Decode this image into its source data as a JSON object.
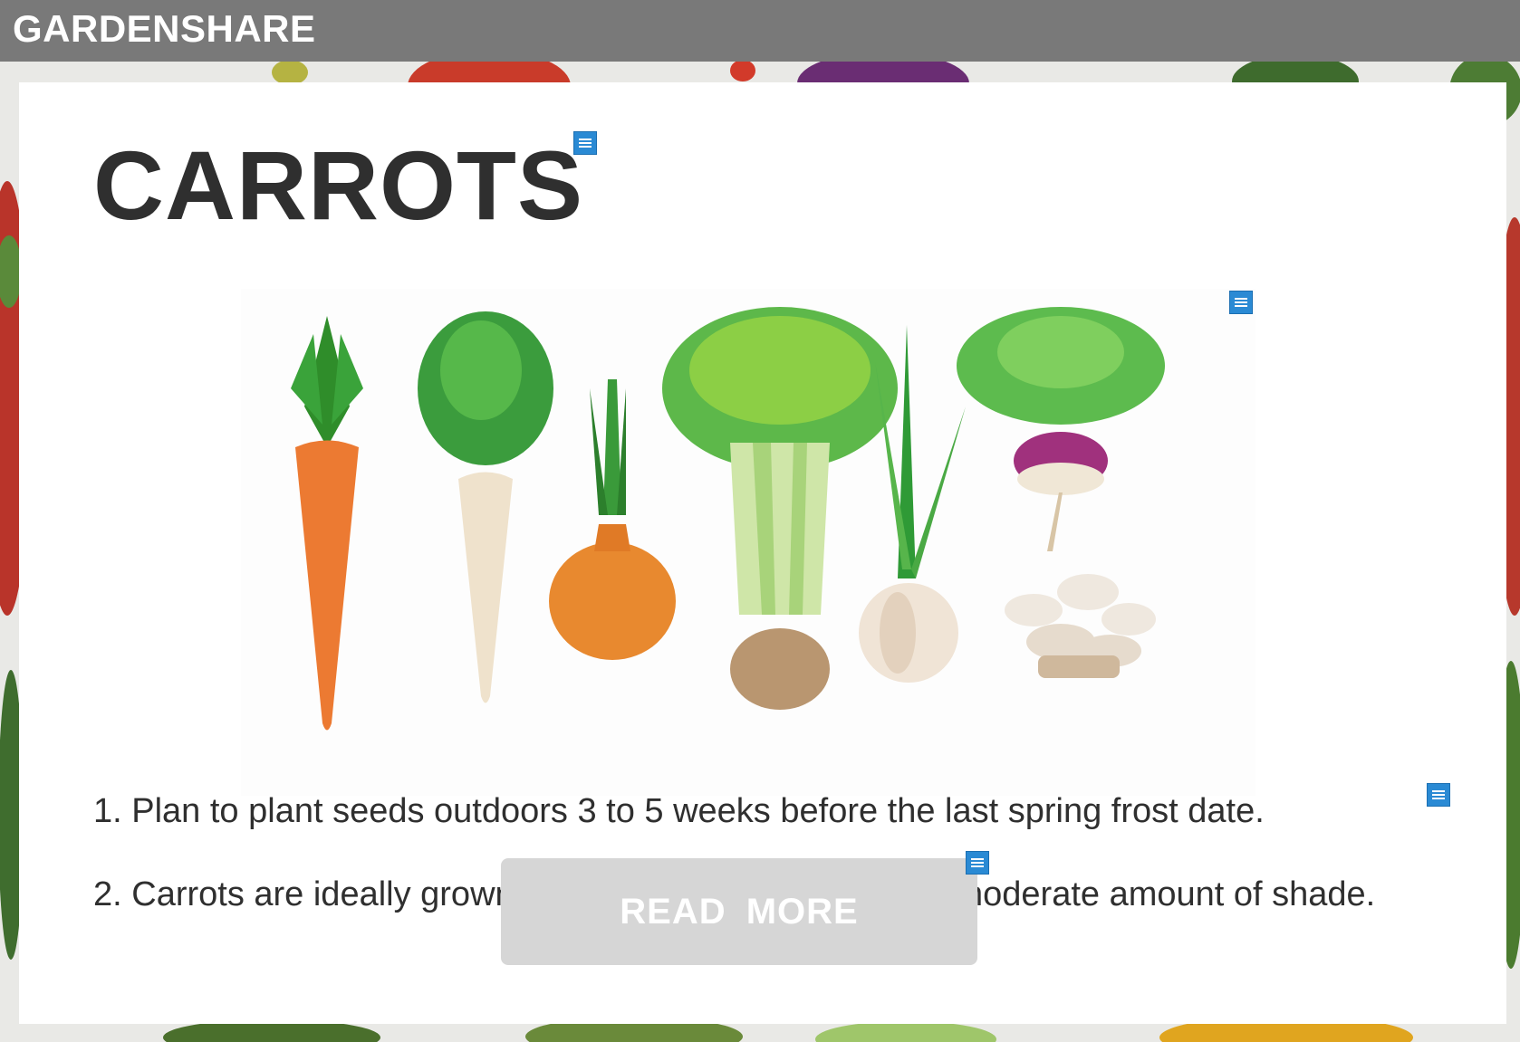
{
  "header": {
    "brand": "GARDENSHARE"
  },
  "article": {
    "title": "CARROTS",
    "image_icon": "vegetables-illustration",
    "tips": [
      "1. Plan to plant seeds outdoors 3 to 5 weeks before the last spring frost date.",
      "2. Carrots are ideally grown in full sun but can tolerate a moderate amount of shade."
    ],
    "read_more_label": "READ  MORE"
  },
  "icons": {
    "edit": "edit-handle-icon"
  },
  "colors": {
    "header_bg": "#797979",
    "edit_icon": "#2a8ad4",
    "button_bg": "#d6d6d6",
    "text": "#2f2f2f"
  }
}
